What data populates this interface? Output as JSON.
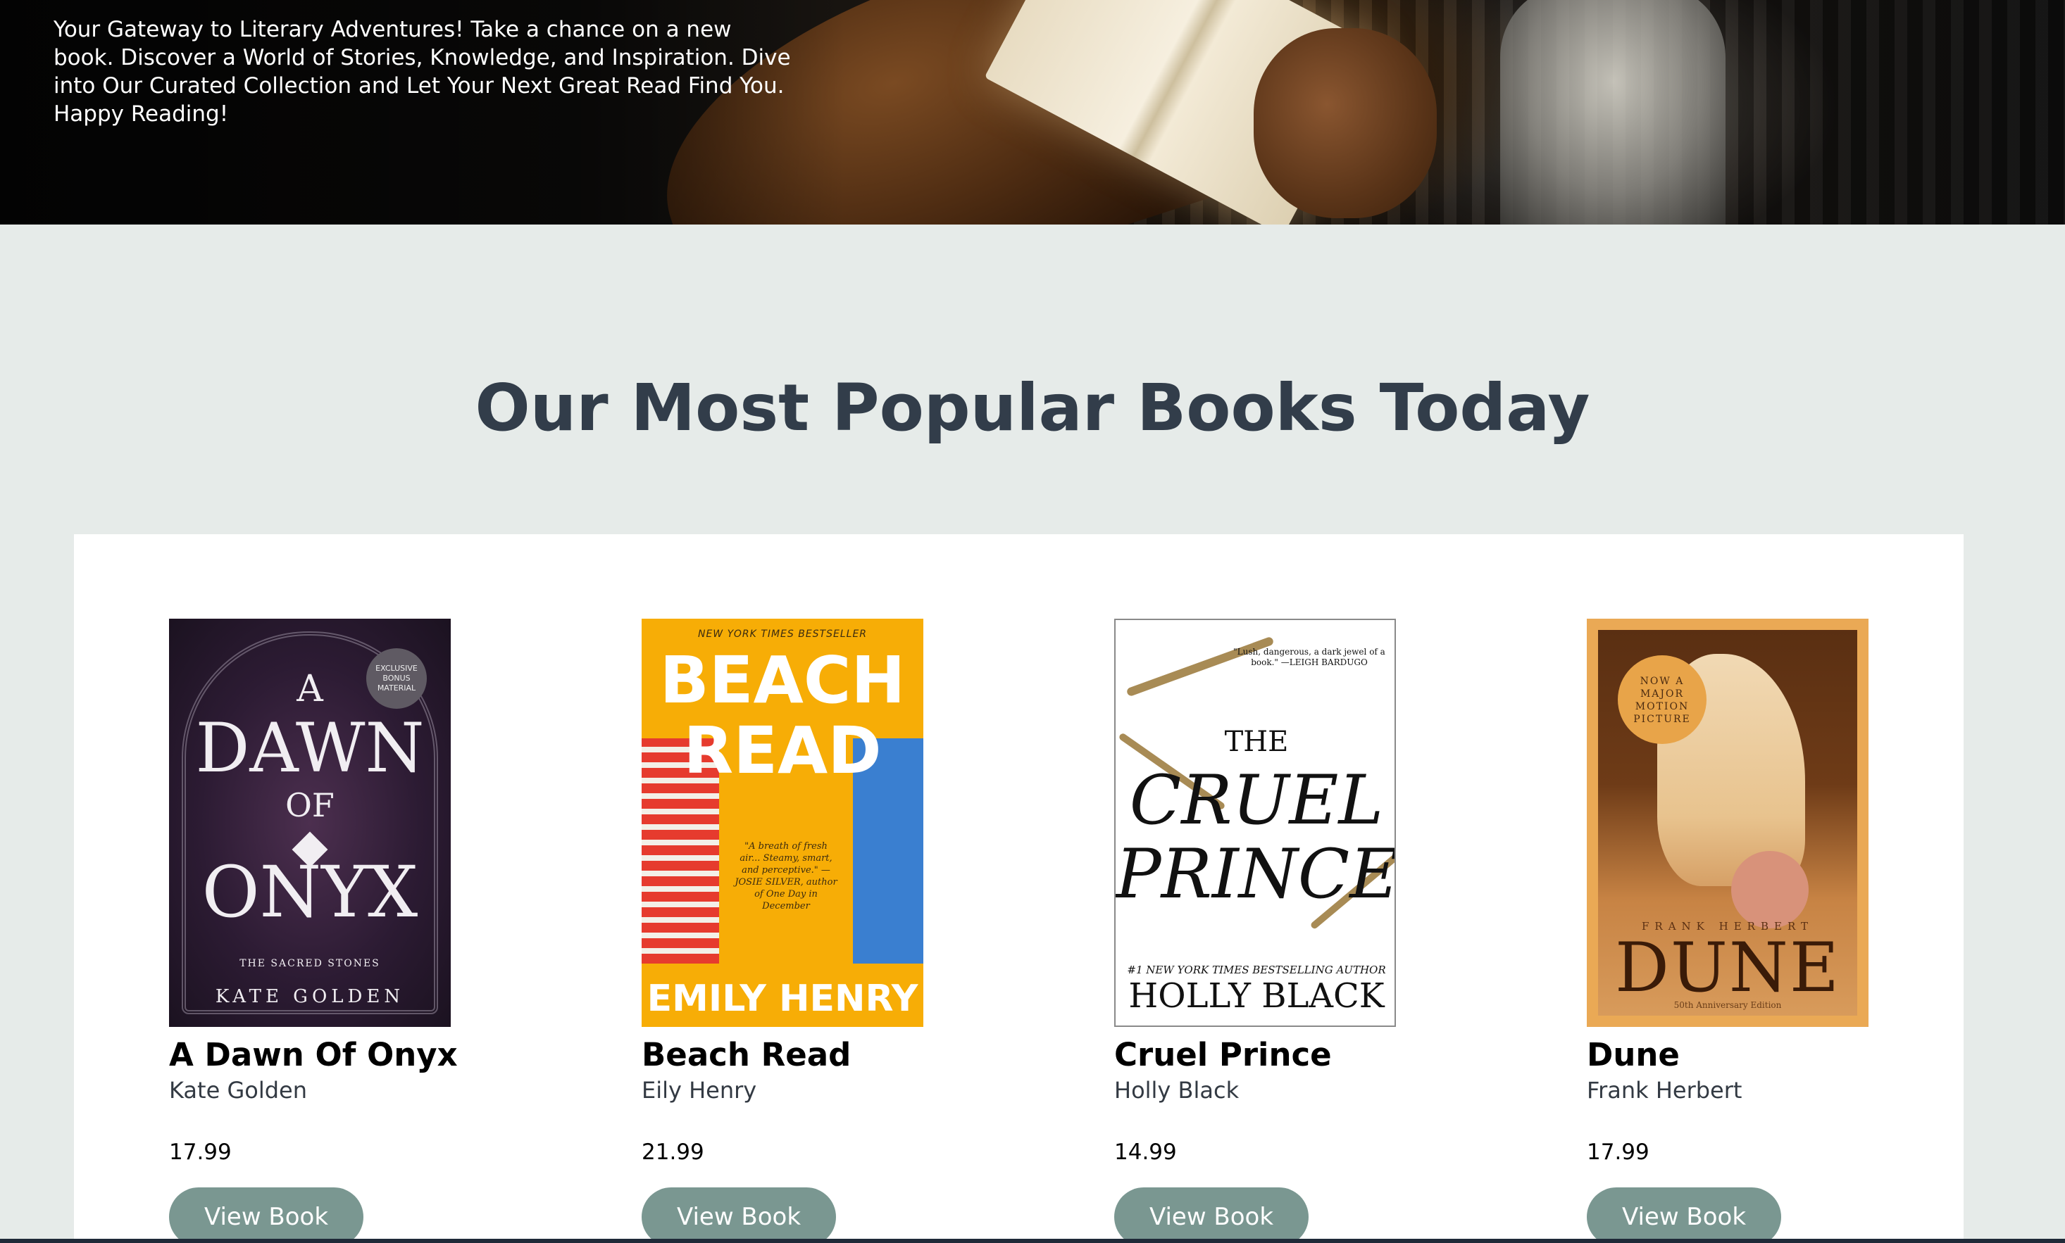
{
  "hero": {
    "tagline": "Your Gateway to Literary Adventures! Take a chance on a new book. Discover a World of Stories, Knowledge, and Inspiration. Dive into Our Curated Collection and Let Your Next Great Read Find You. Happy Reading!"
  },
  "section": {
    "title": "Our Most Popular Books Today"
  },
  "books": [
    {
      "title": "A Dawn Of Onyx",
      "author": "Kate Golden",
      "price": "17.99",
      "button": "View Book",
      "cover": {
        "line1": "A",
        "line2": "DAWN",
        "line3": "OF",
        "line4": "ONYX",
        "badge": "EXCLUSIVE BONUS MATERIAL",
        "series": "THE SACRED STONES",
        "author": "KATE GOLDEN"
      }
    },
    {
      "title": "Beach Read",
      "author": "Eily Henry",
      "price": "21.99",
      "button": "View Book",
      "cover": {
        "kicker": "NEW YORK TIMES BESTSELLER",
        "line1": "BEACH",
        "line2": "READ",
        "quote": "\"A breath of fresh air... Steamy, smart, and perceptive.\" —JOSIE SILVER, author of One Day in December",
        "author": "EMILY HENRY"
      }
    },
    {
      "title": "Cruel Prince",
      "author": "Holly Black",
      "price": "14.99",
      "button": "View Book",
      "cover": {
        "quote": "\"Lush, dangerous, a dark jewel of a book.\" —LEIGH BARDUGO",
        "line1": "THE",
        "line2": "CRUEL",
        "line3": "PRINCE",
        "kicker": "#1 NEW YORK TIMES BESTSELLING AUTHOR",
        "author": "HOLLY BLACK"
      }
    },
    {
      "title": "Dune",
      "author": "Frank Herbert",
      "price": "17.99",
      "button": "View Book",
      "cover": {
        "stamp": "NOW A MAJOR MOTION PICTURE",
        "author": "FRANK HERBERT",
        "title": "DUNE",
        "edition": "50th Anniversary Edition"
      }
    }
  ],
  "colors": {
    "background": "#e6ebe9",
    "panel": "#ffffff",
    "heading": "#323d4a",
    "button": "#7a9791",
    "button_text": "#ffffff"
  }
}
